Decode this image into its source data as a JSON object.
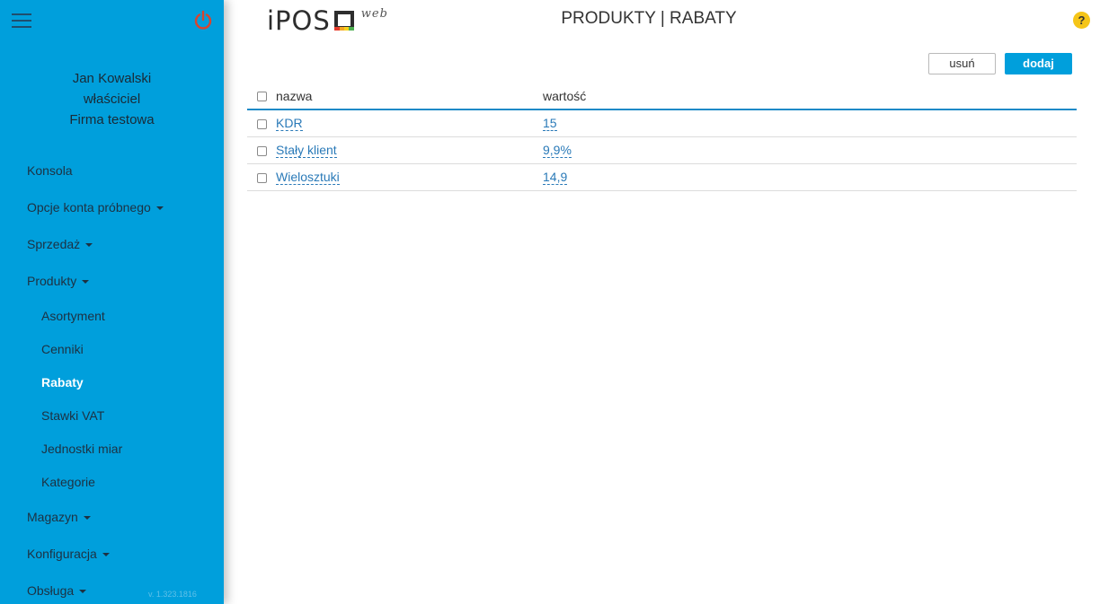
{
  "sidebar": {
    "user": {
      "name": "Jan Kowalski",
      "role": "właściciel",
      "company": "Firma testowa"
    },
    "nav": {
      "konsola": "Konsola",
      "trial": "Opcje konta próbnego",
      "sprzedaz": "Sprzedaż",
      "produkty": "Produkty",
      "asortyment": "Asortyment",
      "cenniki": "Cenniki",
      "rabaty": "Rabaty",
      "vat": "Stawki VAT",
      "jednostki": "Jednostki miar",
      "kategorie": "Kategorie",
      "magazyn": "Magazyn",
      "konfiguracja": "Konfiguracja",
      "obsluga": "Obsługa"
    },
    "version": "v. 1.323.1816",
    "color": "#009fdc"
  },
  "header": {
    "logo_text": "iPOS",
    "logo_suffix": "web",
    "title": "PRODUKTY | RABATY",
    "help": "?"
  },
  "actions": {
    "delete_label": "usuń",
    "add_label": "dodaj"
  },
  "table": {
    "columns": {
      "name": "nazwa",
      "value": "wartość"
    },
    "rows": [
      {
        "name": "KDR",
        "value": "15"
      },
      {
        "name": "Stały klient",
        "value": "9,9%"
      },
      {
        "name": "Wielosztuki",
        "value": "14,9"
      }
    ]
  }
}
